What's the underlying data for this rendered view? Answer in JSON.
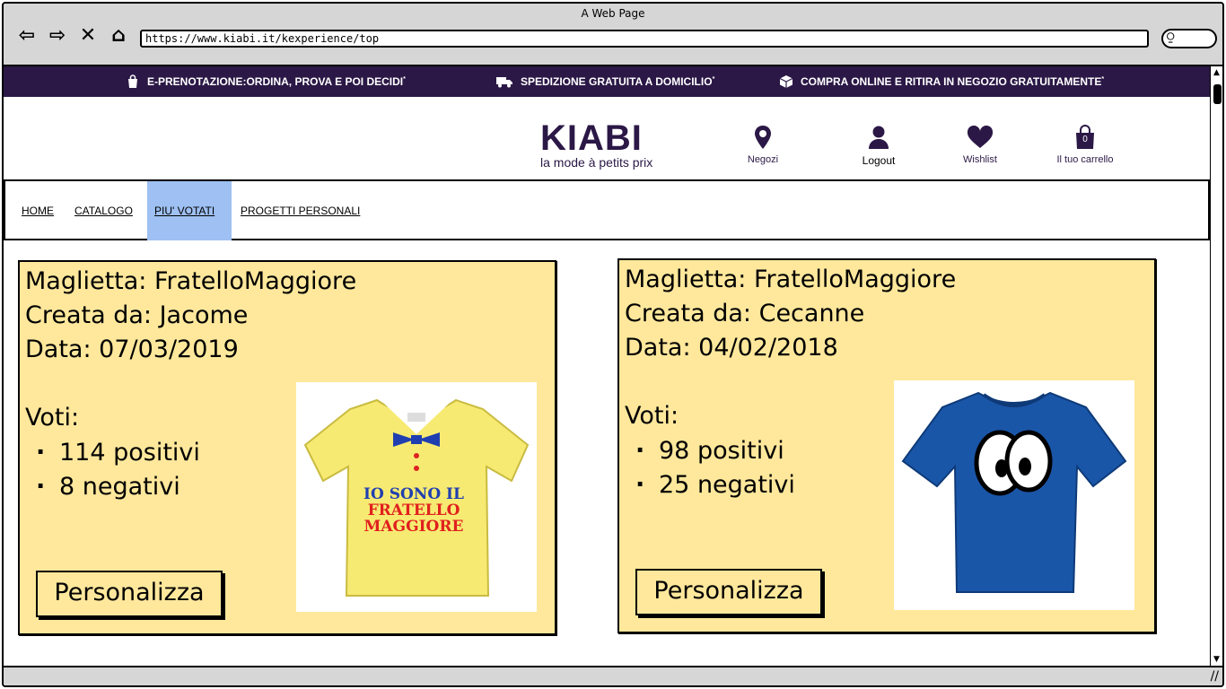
{
  "browser": {
    "window_title": "A Web Page",
    "url": "https://www.kiabi.it/kexperience/top",
    "nav_glyphs": {
      "back": "⇦",
      "forward": "⇨",
      "stop": "✕",
      "home": "⌂",
      "search": "⍜"
    }
  },
  "promo": {
    "items": [
      {
        "icon": "shopping-bag-icon",
        "text": "E-PRENOTAZIONE:ORDINA, PROVA E POI DECIDI",
        "mark": "*"
      },
      {
        "icon": "truck-icon",
        "text": "SPEDIZIONE GRATUITA A DOMICILIO",
        "mark": "*"
      },
      {
        "icon": "box-icon",
        "text": "COMPRA ONLINE E RITIRA IN NEGOZIO GRATUITAMENTE",
        "mark": "*"
      }
    ],
    "background": "#2b1846"
  },
  "header": {
    "logo": {
      "brand": "KIABI",
      "tagline": "la mode à petits prix"
    },
    "links": {
      "stores": "Negozi",
      "logout": "Logout",
      "wishlist": "Wishlist",
      "cart": "Il tuo carrello",
      "cart_count": "0"
    }
  },
  "nav": {
    "tabs": [
      {
        "label": "HOME"
      },
      {
        "label": "CATALOGO"
      },
      {
        "label": "PIU' VOTATI",
        "active": true
      },
      {
        "label": "PROGETTI PERSONALI"
      }
    ],
    "active_color": "#9ec0f2"
  },
  "cards": [
    {
      "title": "Maglietta: FratelloMaggiore",
      "creator": "Creata da: Jacome",
      "date": "Data: 07/03/2019",
      "votes_label": "Voti:",
      "positive": "114 positivi",
      "negative": "8 negativi",
      "button": "Personalizza",
      "shirt_color": "#f7ea72",
      "shirt_text": [
        "IO SONO IL",
        "FRATELLO",
        "MAGGIORE"
      ]
    },
    {
      "title": "Maglietta: FratelloMaggiore",
      "creator": "Creata da: Cecanne",
      "date": "Data: 04/02/2018",
      "votes_label": "Voti:",
      "positive": "98 positivi",
      "negative": "25 negativi",
      "button": "Personalizza",
      "shirt_color": "#1a56a8"
    }
  ],
  "colors": {
    "card_bg": "#ffe89c",
    "chrome_bg": "#d6d6d6"
  }
}
